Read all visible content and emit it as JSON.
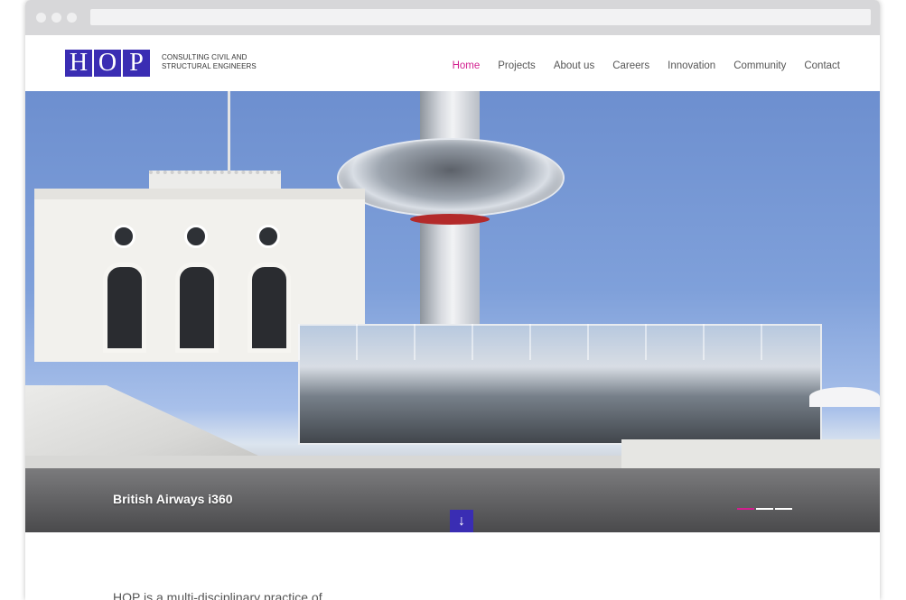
{
  "brand": {
    "logo_letters": [
      "H",
      "O",
      "P"
    ],
    "tagline_line1": "CONSULTING CIVIL AND",
    "tagline_line2": "STRUCTURAL ENGINEERS",
    "accent_color": "#3a2db3",
    "active_color": "#d21f8f"
  },
  "nav": {
    "items": [
      {
        "label": "Home",
        "active": true
      },
      {
        "label": "Projects"
      },
      {
        "label": "About us"
      },
      {
        "label": "Careers"
      },
      {
        "label": "Innovation"
      },
      {
        "label": "Community"
      },
      {
        "label": "Contact"
      }
    ]
  },
  "hero": {
    "caption": "British Airways i360",
    "slides_total": 3,
    "active_slide": 1,
    "scroll_icon": "arrow-down-icon"
  },
  "intro": {
    "text": "HOP is a multi-disciplinary practice of"
  }
}
